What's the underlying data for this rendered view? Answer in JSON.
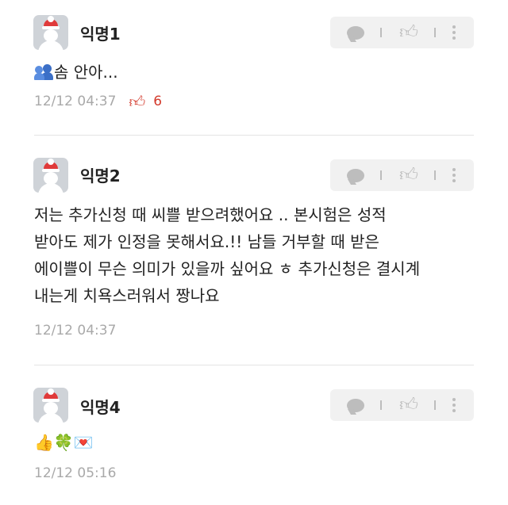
{
  "comments": [
    {
      "author": "익명1",
      "emoji": "",
      "text": "솜 안아...",
      "timestamp": "12/12 04:37",
      "likes": "6"
    },
    {
      "author": "익명2",
      "text": "저는 추가신청 때 씨쁠 받으려했어요 .. 본시험은 성적\n받아도 제가 인정을 못해서요.!! 남들 거부할 때 받은\n에이쁠이 무슨 의미가 있을까 싶어요 ㅎ 추가신청은 결시계\n내는게 치욕스러워서 짱나요",
      "timestamp": "12/12 04:37"
    },
    {
      "author": "익명4",
      "text": "👍🍀💌",
      "timestamp": "12/12 05:16"
    }
  ],
  "icons": {
    "comment": "comment-bubble-icon",
    "like": "thumbs-up-icon",
    "more": "more-vertical-icon",
    "liked": "thumbs-up-outline-icon"
  },
  "colors": {
    "like_red": "#d33a2c",
    "meta_gray": "#a9a9a9",
    "action_bg": "#f1f1f1"
  }
}
